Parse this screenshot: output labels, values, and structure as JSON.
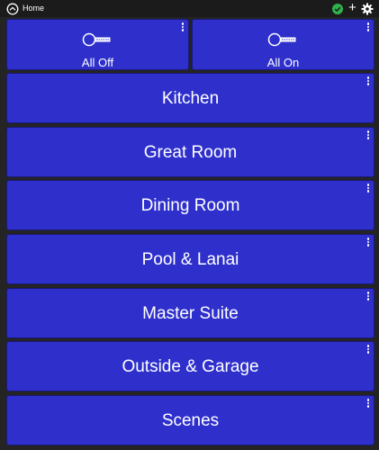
{
  "topbar": {
    "title": "Home",
    "icons": {
      "home": "home-dashboard-icon",
      "status": "check-circle-icon",
      "add": "plus-icon",
      "settings": "gear-icon"
    },
    "add_glyph": "+",
    "status_color": "#2fb24c"
  },
  "colors": {
    "tile_background": "#2f30cc",
    "page_background": "#242424"
  },
  "tiles": [
    {
      "label": "All Off",
      "icon": "switch-bulb-icon"
    },
    {
      "label": "All On",
      "icon": "switch-bulb-icon"
    },
    {
      "label": "Kitchen"
    },
    {
      "label": "Great Room"
    },
    {
      "label": "Dining Room"
    },
    {
      "label": "Pool & Lanai"
    },
    {
      "label": "Master Suite"
    },
    {
      "label": "Outside & Garage"
    },
    {
      "label": "Scenes"
    }
  ]
}
